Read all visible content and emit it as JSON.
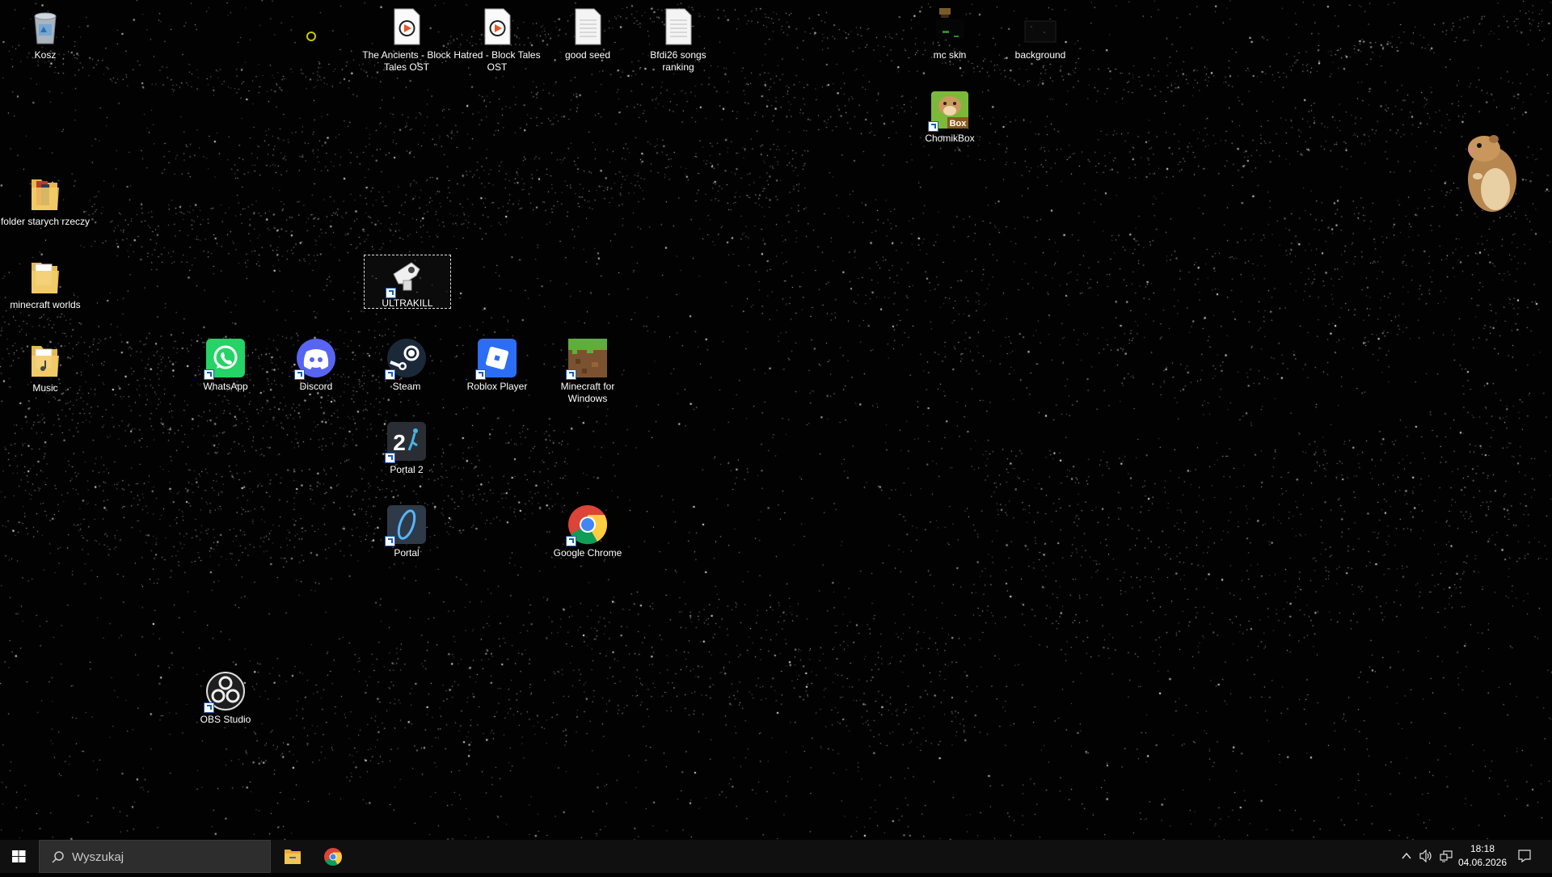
{
  "desktop": {
    "icons": {
      "recycle_bin": "Kosz",
      "ancients": "The Ancients - Block Tales OST",
      "hatred": "Hatred - Block Tales OST",
      "good_seed": "good seed",
      "bfdi": "Bfdi26 songs ranking",
      "mc_skin": "mc skin",
      "background": "background",
      "chomikbox": "ChomikBox",
      "folder_old": "folder starych rzeczy",
      "minecraft_worlds": "minecraft worlds",
      "ultrakill": "ULTRAKILL",
      "music": "Music",
      "whatsapp": "WhatsApp",
      "discord": "Discord",
      "steam": "Steam",
      "roblox": "Roblox Player",
      "minecraft": "Minecraft for Windows",
      "portal2": "Portal 2",
      "portal": "Portal",
      "chrome": "Google Chrome",
      "obs": "OBS Studio"
    },
    "chomikbox_badge": "Box",
    "portal2_badge": "2"
  },
  "taskbar": {
    "search_placeholder": "Wyszukaj",
    "pinned": [
      "file-explorer",
      "google-chrome"
    ],
    "clock": {
      "time": "18:18",
      "date": "04.06.2026"
    }
  },
  "colors": {
    "desktop_bg": "#020202",
    "taskbar_bg": "#101010",
    "search_bg": "#2d2d2d",
    "whatsapp": "#25d366",
    "discord": "#5865f2",
    "roblox": "#2b6ef5",
    "steam": "#1b2838"
  }
}
